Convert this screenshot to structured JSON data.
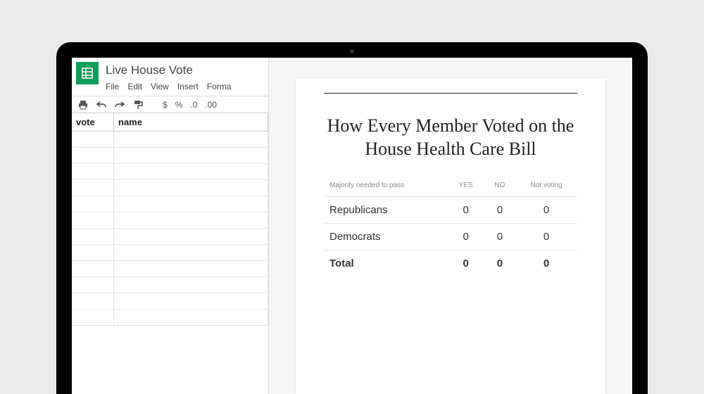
{
  "sheet": {
    "title": "Live House Vote",
    "menu": {
      "file": "File",
      "edit": "Edit",
      "view": "View",
      "insert": "Insert",
      "format": "Forma"
    },
    "fmt": {
      "dollar": "$",
      "percent": "%",
      "dec0": ".0",
      "dec00": ".00"
    },
    "columns": {
      "a": "vote",
      "b": "name"
    }
  },
  "article": {
    "headline": "How Every Member Voted on the House Health Care Bill",
    "table": {
      "note": "Majority needed to pass",
      "col_yes": "YES",
      "col_no": "NO",
      "col_nv": "Not voting",
      "rows": [
        {
          "label": "Republicans",
          "yes": "0",
          "no": "0",
          "nv": "0"
        },
        {
          "label": "Democrats",
          "yes": "0",
          "no": "0",
          "nv": "0"
        }
      ],
      "total": {
        "label": "Total",
        "yes": "0",
        "no": "0",
        "nv": "0"
      }
    }
  }
}
